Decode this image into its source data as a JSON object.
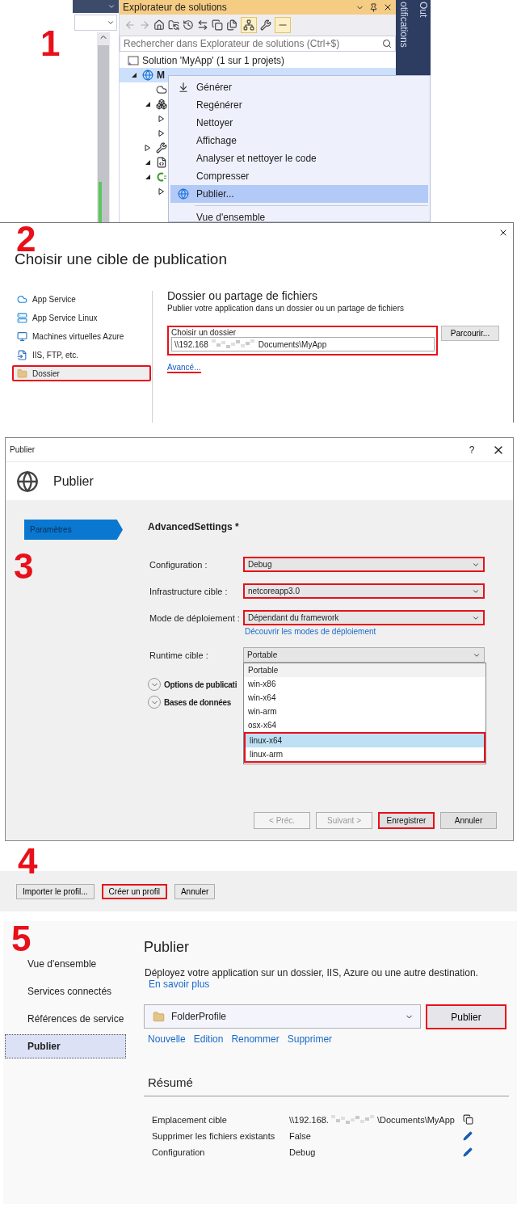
{
  "solution_explorer": {
    "step": "1",
    "title": "Explorateur de solutions",
    "side_tabs": [
      "otifications",
      "Out"
    ],
    "search": {
      "placeholder": "Rechercher dans Explorateur de solutions (Ctrl+$)"
    },
    "tree": [
      {
        "label": "Solution 'MyApp' (1 sur 1 projets)",
        "kind": "solution",
        "selected": false,
        "children": [
          {
            "label": "M",
            "kind": "web-project",
            "selected": true,
            "expanded": true,
            "children": [
              {
                "kind": "cloud",
                "selected": false
              },
              {
                "kind": "dependencies",
                "selected": false,
                "expanded": true,
                "children": [
                  {
                    "selected": false,
                    "expanded": false
                  },
                  {
                    "selected": false,
                    "expanded": false
                  }
                ]
              },
              {
                "kind": "wrench",
                "selected": false,
                "expanded": false
              },
              {
                "kind": "settings-file",
                "selected": false,
                "expanded": true
              },
              {
                "kind": "csharp",
                "selected": false,
                "expanded": true,
                "children": [
                  {
                    "selected": false,
                    "expanded": false
                  }
                ]
              }
            ]
          }
        ]
      }
    ],
    "context_menu": [
      {
        "kind": "build",
        "label": "Générer",
        "selected": false
      },
      {
        "kind": "item",
        "label": "Regénérer",
        "selected": false
      },
      {
        "kind": "item",
        "label": "Nettoyer",
        "selected": false
      },
      {
        "kind": "item",
        "label": "Affichage",
        "selected": false
      },
      {
        "kind": "item",
        "label": "Analyser et nettoyer le code",
        "selected": false
      },
      {
        "kind": "item",
        "label": "Compresser",
        "selected": false
      },
      {
        "kind": "publish",
        "label": "Publier...",
        "selected": true
      },
      {
        "kind": "separator"
      },
      {
        "kind": "item",
        "label": "Vue d'ensemble",
        "selected": false
      }
    ]
  },
  "publish_target": {
    "step": "2",
    "title": "Choisir une cible de publication",
    "targets": [
      {
        "label": "App Service",
        "kind": "cloud",
        "selected": false,
        "highlighted": false
      },
      {
        "label": "App Service Linux",
        "kind": "server",
        "selected": false,
        "highlighted": false
      },
      {
        "label": "Machines virtuelles Azure",
        "kind": "monitor",
        "selected": false,
        "highlighted": false
      },
      {
        "label": "IIS, FTP, etc.",
        "kind": "file",
        "selected": false,
        "highlighted": false
      },
      {
        "label": "Dossier",
        "kind": "folder",
        "selected": true,
        "highlighted": true
      }
    ],
    "panel": {
      "heading": "Dossier ou partage de fichiers",
      "subheading": "Publier votre application dans un dossier ou un partage de fichiers",
      "folder_field": {
        "label": "Choisir un dossier",
        "value_start": "\\\\192.168",
        "value_end": "Documents\\MyApp",
        "highlighted": true
      },
      "browse_button": "Parcourir...",
      "advanced_link": {
        "label": "Avancé...",
        "highlighted": true
      }
    }
  },
  "publish_dialog": {
    "step": "3",
    "window_title": "Publier",
    "help": "?",
    "header_title": "Publier",
    "nav": [
      {
        "label": "Paramètres",
        "selected": true
      }
    ],
    "profile_name": "AdvancedSettings *",
    "fields": [
      {
        "label": "Configuration :",
        "value": "Debug",
        "highlighted": true
      },
      {
        "label": "Infrastructure cible :",
        "value": "netcoreapp3.0",
        "highlighted": true
      },
      {
        "label": "Mode de déploiement :",
        "value": "Dépendant du framework",
        "highlighted": true,
        "help_link": "Découvrir les modes de déploiement"
      },
      {
        "label": "Runtime cible :",
        "value": "Portable",
        "highlighted": false,
        "expanded": true
      }
    ],
    "runtime_options": [
      {
        "label": "Portable",
        "selected": false,
        "highlighted": false
      },
      {
        "label": "win-x86",
        "selected": false,
        "highlighted": false
      },
      {
        "label": "win-x64",
        "selected": false,
        "highlighted": false
      },
      {
        "label": "win-arm",
        "selected": false,
        "highlighted": false
      },
      {
        "label": "osx-x64",
        "selected": false,
        "highlighted": false
      },
      {
        "label": "linux-x64",
        "selected": true,
        "highlighted": true
      },
      {
        "label": "linux-arm",
        "selected": false,
        "highlighted": true
      }
    ],
    "sections": [
      {
        "label": "Options de publicati",
        "expanded": false
      },
      {
        "label": "Bases de données",
        "expanded": false
      }
    ],
    "buttons": [
      {
        "label": "< Préc.",
        "disabled": true,
        "highlighted": false
      },
      {
        "label": "Suivant >",
        "disabled": true,
        "highlighted": false
      },
      {
        "label": "Enregistrer",
        "disabled": false,
        "highlighted": true
      },
      {
        "label": "Annuler",
        "disabled": false,
        "highlighted": false
      }
    ]
  },
  "profile_footer": {
    "step": "4",
    "buttons": [
      {
        "label": "Importer le profil...",
        "highlighted": false
      },
      {
        "label": "Créer un profil",
        "highlighted": true
      },
      {
        "label": "Annuler",
        "highlighted": false
      }
    ]
  },
  "publish_page": {
    "step": "5",
    "nav": [
      {
        "label": "Vue d'ensemble",
        "selected": false
      },
      {
        "label": "Services connectés",
        "selected": false
      },
      {
        "label": "Références de service",
        "selected": false
      },
      {
        "label": "Publier",
        "selected": true
      }
    ],
    "title": "Publier",
    "description": "Déployez votre application sur un dossier, IIS, Azure ou une autre destination.",
    "learn_more": "En savoir plus",
    "profile_select": {
      "value": "FolderProfile"
    },
    "publish_button": {
      "label": "Publier",
      "highlighted": true
    },
    "actions": [
      "Nouvelle",
      "Edition",
      "Renommer",
      "Supprimer"
    ],
    "summary": {
      "title": "Résumé",
      "rows": [
        {
          "label": "Emplacement cible",
          "value_start": "\\\\192.168.",
          "value_end": "\\Documents\\MyApp",
          "kind": "copy"
        },
        {
          "label": "Supprimer les fichiers existants",
          "value": "False",
          "kind": "edit"
        },
        {
          "label": "Configuration",
          "value": "Debug",
          "kind": "edit"
        }
      ]
    }
  }
}
